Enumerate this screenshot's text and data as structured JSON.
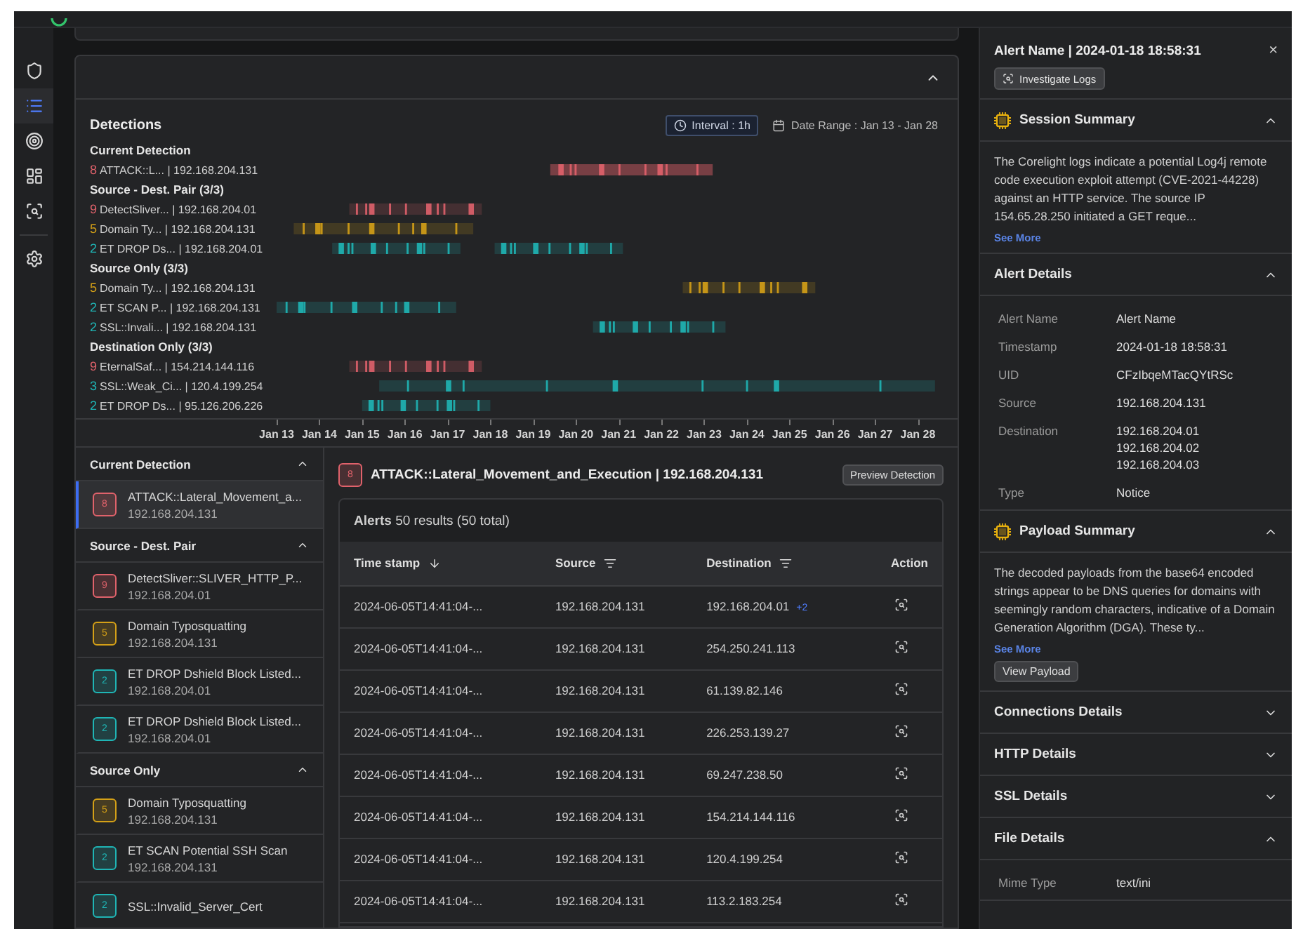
{
  "timeline": {
    "title": "Detections",
    "interval": "Interval : 1h",
    "date_range": "Date Range : Jan 13 - Jan 28",
    "groups": [
      {
        "title": "Current Detection",
        "rows": [
          {
            "severity": "8",
            "color": "#e0626b",
            "name": "ATTACK::L...",
            "ip": "| 192.168.204.131"
          }
        ]
      },
      {
        "title": "Source - Dest. Pair (3/3)",
        "rows": [
          {
            "severity": "9",
            "color": "#e0626b",
            "name": "DetectSliver...",
            "ip": "| 192.168.204.01"
          },
          {
            "severity": "5",
            "color": "#d4a017",
            "name": "Domain Ty...",
            "ip": "| 192.168.204.131"
          },
          {
            "severity": "2",
            "color": "#1fb5b5",
            "name": "ET DROP Ds...",
            "ip": "| 192.168.204.01"
          }
        ]
      },
      {
        "title": "Source Only (3/3)",
        "rows": [
          {
            "severity": "5",
            "color": "#d4a017",
            "name": "Domain Ty...",
            "ip": "| 192.168.204.131"
          },
          {
            "severity": "2",
            "color": "#1fb5b5",
            "name": "ET SCAN P...",
            "ip": "| 192.168.204.131"
          },
          {
            "severity": "2",
            "color": "#1fb5b5",
            "name": "SSL::Invali...",
            "ip": "| 192.168.204.131"
          }
        ]
      },
      {
        "title": "Destination Only (3/3)",
        "rows": [
          {
            "severity": "9",
            "color": "#e0626b",
            "name": "EternalSaf...",
            "ip": "| 154.214.144.116"
          },
          {
            "severity": "3",
            "color": "#1fb5b5",
            "name": "SSL::Weak_Ci...",
            "ip": "| 120.4.199.254"
          },
          {
            "severity": "2",
            "color": "#1fb5b5",
            "name": "ET DROP Ds...",
            "ip": "| 95.126.206.226"
          }
        ]
      }
    ],
    "ticks": [
      "Jan 13",
      "Jan 14",
      "Jan 15",
      "Jan 16",
      "Jan 17",
      "Jan 18",
      "Jan 19",
      "Jan 20",
      "Jan 21",
      "Jan 22",
      "Jan 23",
      "Jan 24",
      "Jan 25",
      "Jan 26",
      "Jan 27",
      "Jan 28"
    ]
  },
  "detection_list": [
    {
      "title": "Current Detection",
      "expanded": true,
      "items": [
        {
          "severity": "8",
          "color": "#e0626b",
          "name": "ATTACK::Lateral_Movement_a...",
          "ip": "192.168.204.131",
          "selected": true
        }
      ]
    },
    {
      "title": "Source - Dest. Pair",
      "expanded": true,
      "items": [
        {
          "severity": "9",
          "color": "#e0626b",
          "name": "DetectSliver::SLIVER_HTTP_P...",
          "ip": "192.168.204.01",
          "selected": false
        },
        {
          "severity": "5",
          "color": "#d4a017",
          "name": "Domain Typosquatting",
          "ip": "192.168.204.131",
          "selected": false
        },
        {
          "severity": "2",
          "color": "#1fb5b5",
          "name": "ET DROP Dshield Block Listed...",
          "ip": "192.168.204.01",
          "selected": false
        },
        {
          "severity": "2",
          "color": "#1fb5b5",
          "name": "ET DROP Dshield Block Listed...",
          "ip": "192.168.204.01",
          "selected": false
        }
      ]
    },
    {
      "title": "Source Only",
      "expanded": true,
      "items": [
        {
          "severity": "5",
          "color": "#d4a017",
          "name": "Domain Typosquatting",
          "ip": "192.168.204.131",
          "selected": false
        },
        {
          "severity": "2",
          "color": "#1fb5b5",
          "name": "ET SCAN Potential SSH Scan",
          "ip": "192.168.204.131",
          "selected": false
        },
        {
          "severity": "2",
          "color": "#1fb5b5",
          "name": "SSL::Invalid_Server_Cert",
          "selected": false
        }
      ]
    }
  ],
  "detail": {
    "severity": "8",
    "color": "#e0626b",
    "title": "ATTACK::Lateral_Movement_and_Execution | 192.168.204.131",
    "preview_button": "Preview Detection",
    "alerts_title": "Alerts",
    "alerts_count": "50 results (50 total)",
    "columns": [
      {
        "label": "Time stamp",
        "kind": "sort"
      },
      {
        "label": "Source",
        "kind": "filter"
      },
      {
        "label": "Destination",
        "kind": "filter"
      },
      {
        "label": "Action",
        "kind": "plain"
      }
    ],
    "rows": [
      {
        "time": "2024-06-05T14:41:04-...",
        "source": "192.168.204.131",
        "destination": "192.168.204.01",
        "extra": "+2"
      },
      {
        "time": "2024-06-05T14:41:04-...",
        "source": "192.168.204.131",
        "destination": "254.250.241.113"
      },
      {
        "time": "2024-06-05T14:41:04-...",
        "source": "192.168.204.131",
        "destination": "61.139.82.146"
      },
      {
        "time": "2024-06-05T14:41:04-...",
        "source": "192.168.204.131",
        "destination": "226.253.139.27"
      },
      {
        "time": "2024-06-05T14:41:04-...",
        "source": "192.168.204.131",
        "destination": "69.247.238.50"
      },
      {
        "time": "2024-06-05T14:41:04-...",
        "source": "192.168.204.131",
        "destination": "154.214.144.116"
      },
      {
        "time": "2024-06-05T14:41:04-...",
        "source": "192.168.204.131",
        "destination": "120.4.199.254"
      },
      {
        "time": "2024-06-05T14:41:04-...",
        "source": "192.168.204.131",
        "destination": "113.2.183.254"
      }
    ]
  },
  "side_panel": {
    "title": "Alert Name | 2024-01-18 18:58:31",
    "close": "×",
    "investigate_button": "Investigate Logs",
    "sections": [
      {
        "kind": "summary",
        "title": "Session Summary",
        "expanded": true,
        "text": "The Corelight logs indicate a potential Log4j remote code execution exploit attempt (CVE-2021-44228) against an HTTP service. The source IP 154.65.28.250 initiated a GET reque...",
        "link": "See More"
      },
      {
        "kind": "details",
        "title": "Alert Details",
        "expanded": true,
        "fields": [
          {
            "label": "Alert Name",
            "values": [
              "Alert Name"
            ]
          },
          {
            "label": "Timestamp",
            "values": [
              "2024-01-18 18:58:31"
            ]
          },
          {
            "label": "UID",
            "values": [
              "CFzIbqeMTacQYtRSc"
            ]
          },
          {
            "label": "Source",
            "values": [
              "192.168.204.131"
            ]
          },
          {
            "label": "Destination",
            "values": [
              "192.168.204.01",
              "192.168.204.02",
              "192.168.204.03"
            ]
          },
          {
            "label": "Type",
            "values": [
              "Notice"
            ]
          }
        ]
      },
      {
        "kind": "summary",
        "title": "Payload Summary",
        "expanded": true,
        "text": "The decoded payloads from the base64 encoded strings appear to be DNS queries for domains with seemingly random characters, indicative of a Domain Generation Algorithm (DGA). These ty...",
        "link": "See More",
        "button": "View Payload"
      },
      {
        "kind": "plain",
        "title": "Connections Details",
        "expanded": false
      },
      {
        "kind": "plain",
        "title": "HTTP Details",
        "expanded": false
      },
      {
        "kind": "plain",
        "title": "SSL Details",
        "expanded": false
      },
      {
        "kind": "details",
        "title": "File Details",
        "expanded": true,
        "fields": [
          {
            "label": "Mime Type",
            "values": [
              "text/ini"
            ]
          }
        ]
      }
    ]
  }
}
